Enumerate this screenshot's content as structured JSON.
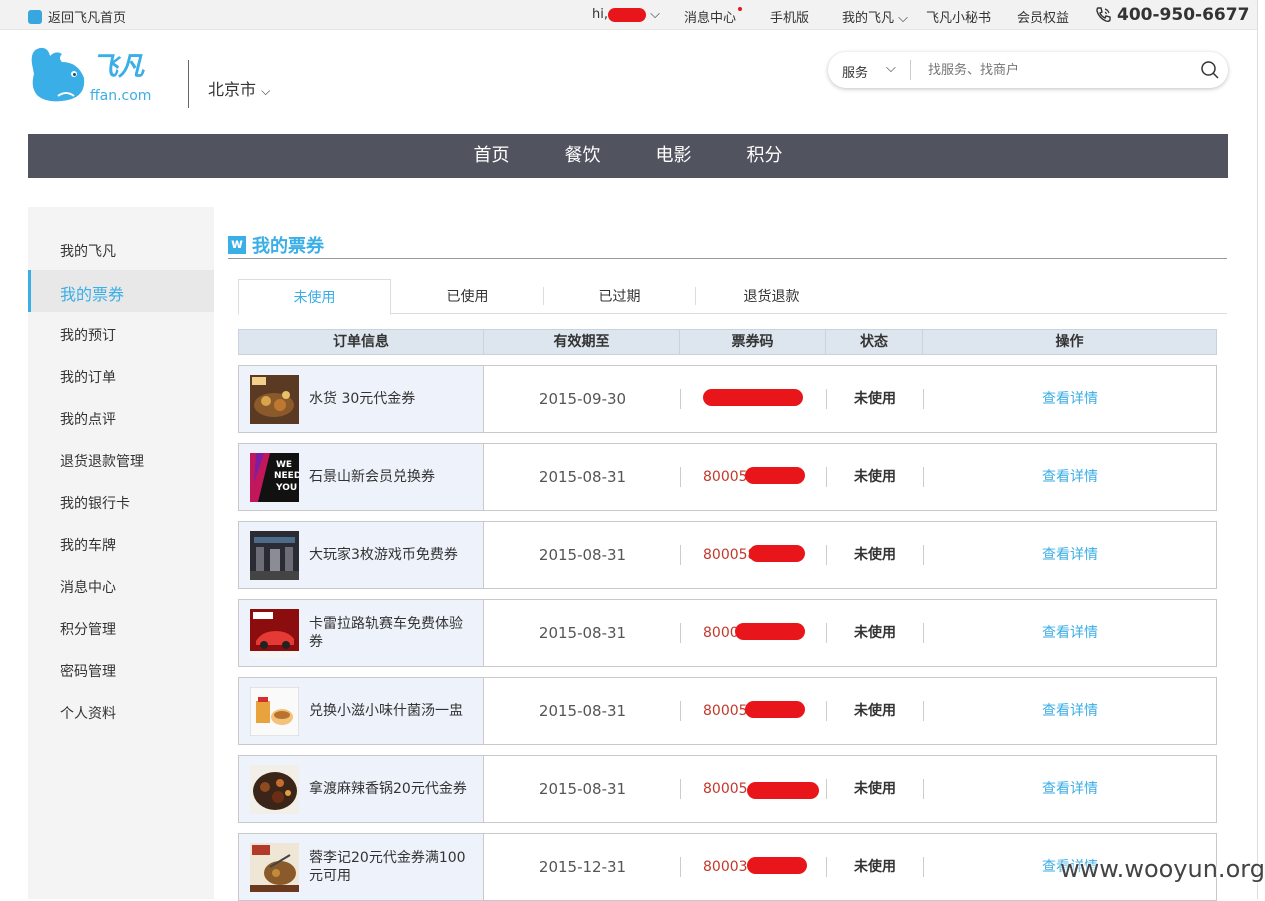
{
  "topbar": {
    "back_home": "返回飞凡首页",
    "greeting": "hi,",
    "messages": "消息中心",
    "mobile": "手机版",
    "my_feifan": "我的飞凡",
    "secretary": "飞凡小秘书",
    "member_rights": "会员权益",
    "phone": "400-950-6677"
  },
  "header": {
    "logo_text": "ffan.com",
    "logo_mark": "飞凡",
    "city": "北京市",
    "search": {
      "scope": "服务",
      "placeholder": "找服务、找商户"
    }
  },
  "nav": {
    "items": [
      "首页",
      "餐饮",
      "电影",
      "积分"
    ]
  },
  "sidebar": {
    "items": [
      "我的飞凡",
      "我的票券",
      "我的预订",
      "我的订单",
      "我的点评",
      "退货退款管理",
      "我的银行卡",
      "我的车牌",
      "消息中心",
      "积分管理",
      "密码管理",
      "个人资料"
    ],
    "active": "我的票券"
  },
  "page": {
    "title": "我的票券",
    "title_badge": "w"
  },
  "tabs": [
    "未使用",
    "已使用",
    "已过期",
    "退货退款"
  ],
  "table": {
    "headers": [
      "订单信息",
      "有效期至",
      "票券码",
      "状态",
      "操作"
    ],
    "rows": [
      {
        "name": "水货 30元代金券",
        "date": "2015-09-30",
        "code": "",
        "status": "未使用",
        "action": "查看详情"
      },
      {
        "name": "石景山新会员兑换券",
        "date": "2015-08-31",
        "code": "80005",
        "status": "未使用",
        "action": "查看详情"
      },
      {
        "name": "大玩家3枚游戏币免费券",
        "date": "2015-08-31",
        "code": "800058",
        "status": "未使用",
        "action": "查看详情"
      },
      {
        "name": "卡雷拉路轨赛车免费体验券",
        "date": "2015-08-31",
        "code": "8000",
        "status": "未使用",
        "action": "查看详情"
      },
      {
        "name": "兑换小滋小味什菌汤一盅",
        "date": "2015-08-31",
        "code": "80005",
        "status": "未使用",
        "action": "查看详情"
      },
      {
        "name": "拿渡麻辣香锅20元代金券",
        "date": "2015-08-31",
        "code": "80005",
        "status": "未使用",
        "action": "查看详情"
      },
      {
        "name": "蓉李记20元代金券满100元可用",
        "date": "2015-12-31",
        "code": "80003",
        "status": "未使用",
        "action": "查看详情"
      }
    ]
  },
  "watermark": "www.wooyun.org",
  "colors": {
    "accent": "#3aaee6",
    "nav_bg": "#51545e",
    "code_red": "#c0392b",
    "redaction": "#e8161b"
  }
}
